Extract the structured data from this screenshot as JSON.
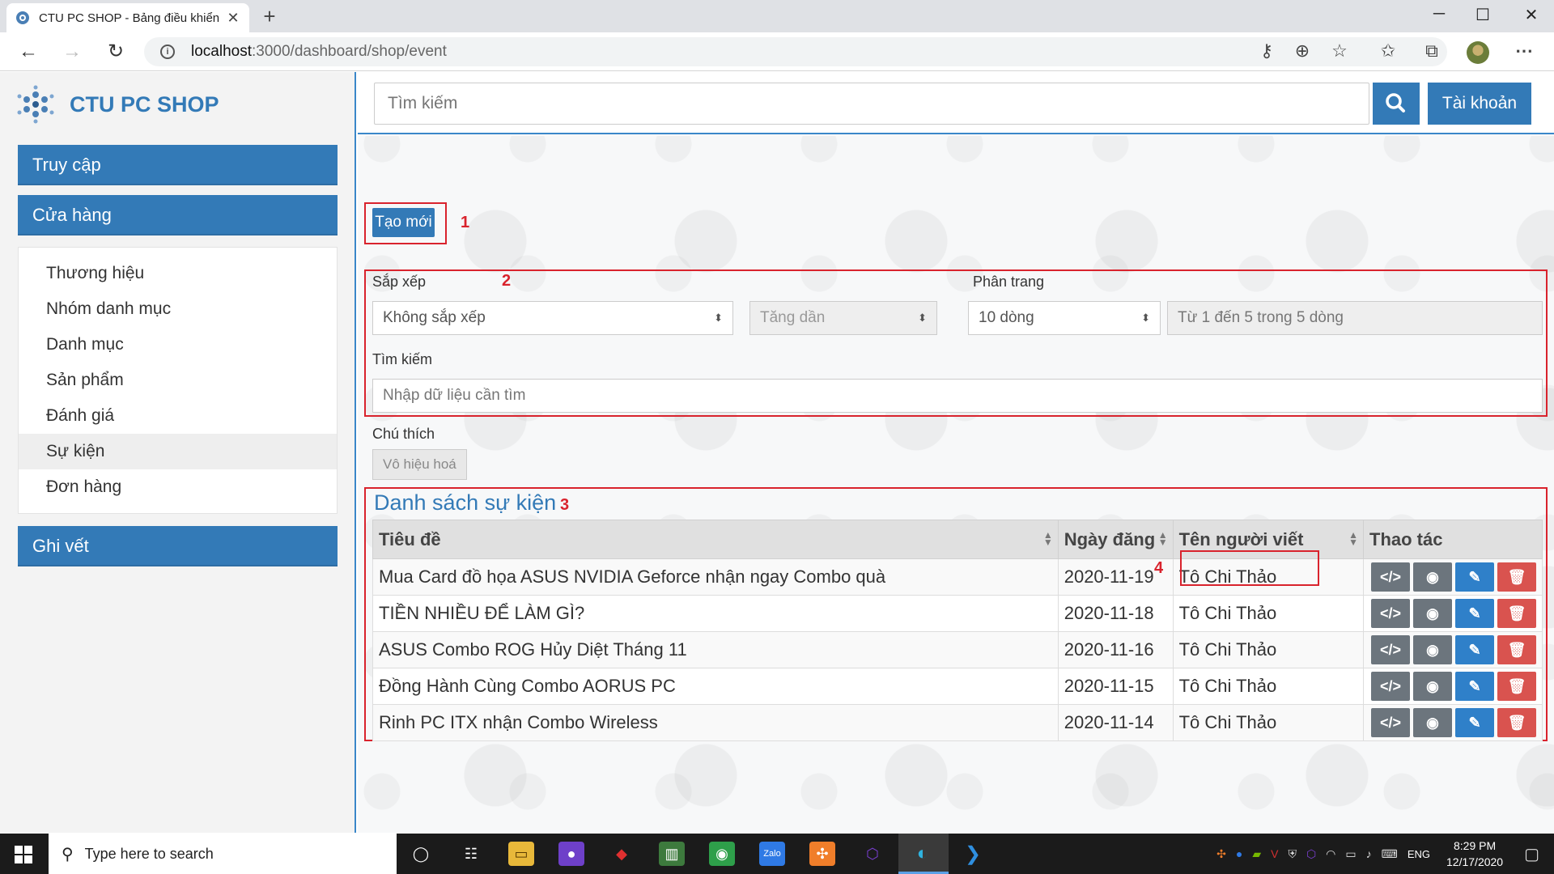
{
  "browser": {
    "tab_title": "CTU PC SHOP - Bảng điều khiển",
    "url_host": "localhost",
    "url_path": ":3000/dashboard/shop/event"
  },
  "brand": {
    "name": "CTU PC SHOP"
  },
  "sidebar": {
    "access": "Truy cập",
    "shop": "Cửa hàng",
    "items": [
      "Thương hiệu",
      "Nhóm danh mục",
      "Danh mục",
      "Sản phẩm",
      "Đánh giá",
      "Sự kiện",
      "Đơn hàng"
    ],
    "active_item": "Sự kiện",
    "posts": "Ghi vết"
  },
  "topbar": {
    "search_placeholder": "Tìm kiếm",
    "account_label": "Tài khoản"
  },
  "toolbar": {
    "create_label": "Tạo mới",
    "annotation_1": "1"
  },
  "filters": {
    "annotation_2": "2",
    "sort_label": "Sắp xếp",
    "sort_value": "Không sắp xếp",
    "order_value": "Tăng dần",
    "paging_label": "Phân trang",
    "paging_value": "10 dòng",
    "range_text": "Từ 1 đến 5 trong 5 dòng",
    "search_label": "Tìm kiếm",
    "search_placeholder": "Nhập dữ liệu cần tìm"
  },
  "note": {
    "label": "Chú thích",
    "disabled_label": "Vô hiệu hoá"
  },
  "events": {
    "title": "Danh sách sự kiện",
    "annotation_3": "3",
    "annotation_4": "4",
    "columns": [
      "Tiêu đề",
      "Ngày đăng",
      "Tên người viết",
      "Thao tác"
    ],
    "rows": [
      {
        "title": "Mua Card đồ họa ASUS NVIDIA Geforce nhận ngay Combo quà",
        "date": "2020-11-19",
        "author": "Tô Chi Thảo"
      },
      {
        "title": "TIỀN NHIỀU ĐỂ LÀM GÌ?",
        "date": "2020-11-18",
        "author": "Tô Chi Thảo"
      },
      {
        "title": "ASUS Combo ROG Hủy Diệt Tháng 11",
        "date": "2020-11-16",
        "author": "Tô Chi Thảo"
      },
      {
        "title": "Đồng Hành Cùng Combo AORUS PC",
        "date": "2020-11-15",
        "author": "Tô Chi Thảo"
      },
      {
        "title": "Rinh PC ITX nhận Combo Wireless",
        "date": "2020-11-14",
        "author": "Tô Chi Thảo"
      }
    ],
    "action_icons": [
      "code-icon",
      "eye-icon",
      "edit-icon",
      "trash-icon"
    ]
  },
  "taskbar": {
    "search_text": "Type here to search",
    "lang": "ENG",
    "time": "8:29 PM",
    "date": "12/17/2020"
  },
  "colors": {
    "primary": "#337ab7",
    "annotation": "#d9232d",
    "delete": "#d9534f",
    "secondary": "#6c757d"
  }
}
